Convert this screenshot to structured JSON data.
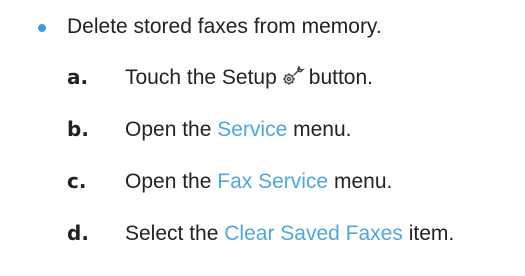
{
  "intro": {
    "text": "Delete stored faxes from memory."
  },
  "steps": [
    {
      "letter": "a.",
      "before": "Touch the Setup",
      "icon": "setup-wrench-gear-icon",
      "after": "button."
    },
    {
      "letter": "b.",
      "before": "Open the",
      "term": "Service",
      "after": "menu."
    },
    {
      "letter": "c.",
      "before": "Open the",
      "term": "Fax Service",
      "after": "menu."
    },
    {
      "letter": "d.",
      "before": "Select the",
      "term": "Clear Saved Faxes",
      "after": "item."
    }
  ],
  "colors": {
    "bullet": "#3f9bd8",
    "term": "#4ea7df",
    "text": "#222222"
  }
}
